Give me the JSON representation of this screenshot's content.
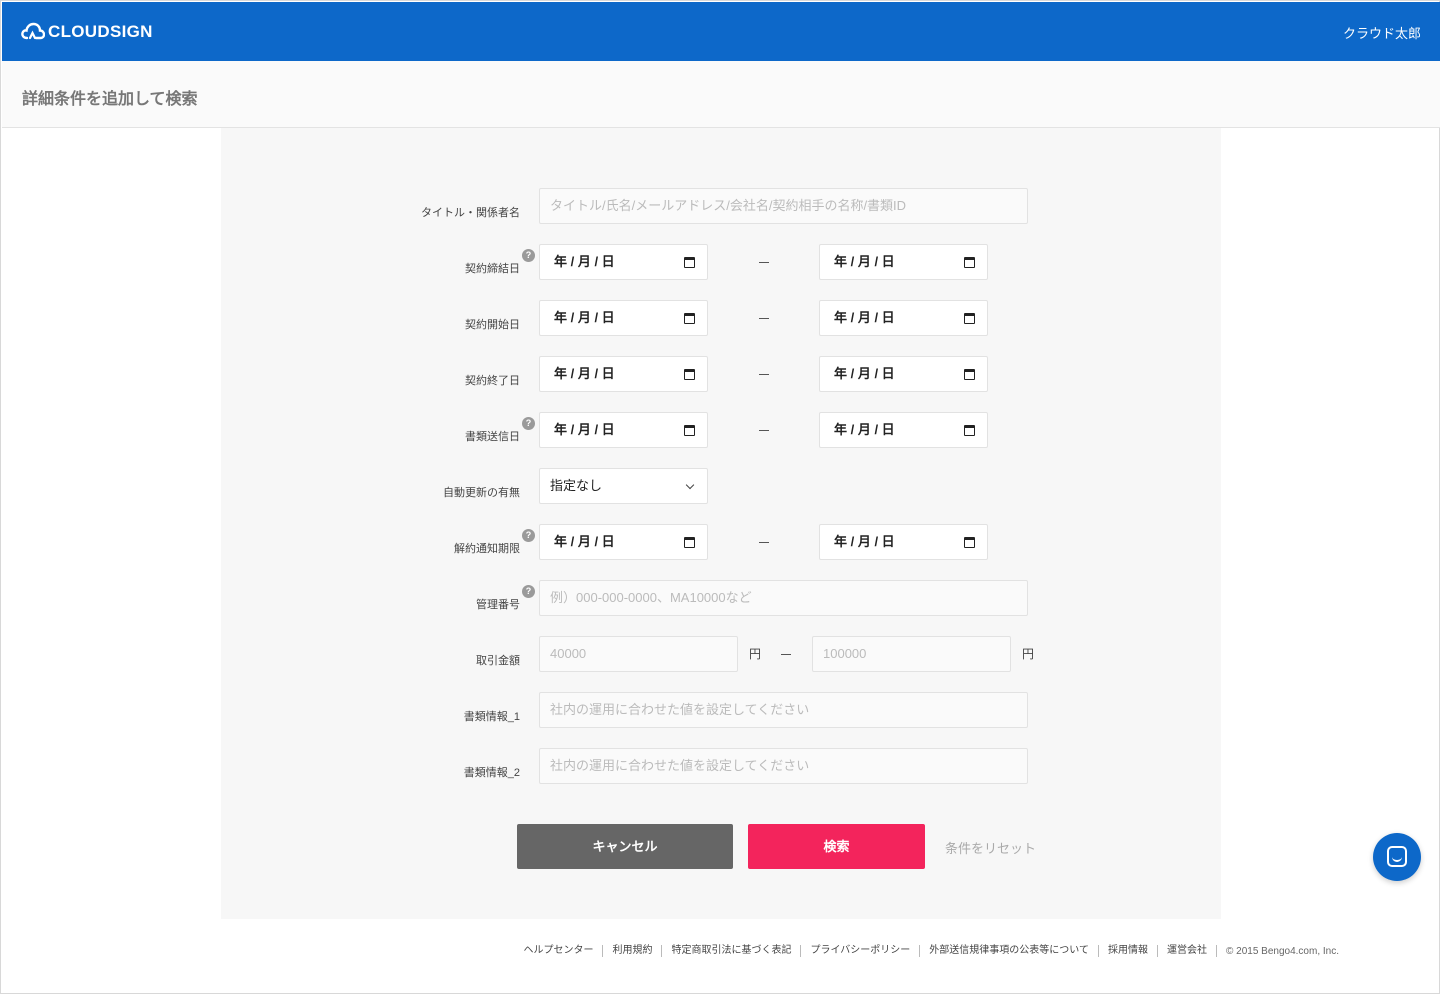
{
  "header": {
    "logo_text": "CLOUDSIGN",
    "user_name": "クラウド太郎",
    "brand_color": "#0d68c9"
  },
  "page": {
    "title": "詳細条件を追加して検索"
  },
  "form": {
    "title_field": {
      "label": "タイトル・関係者名",
      "placeholder": "タイトル/氏名/メールアドレス/会社名/契約相手の名称/書類ID"
    },
    "date_placeholder": "年 / 月 / 日",
    "contract_date": {
      "label": "契約締結日",
      "help": "?"
    },
    "start_date": {
      "label": "契約開始日"
    },
    "end_date": {
      "label": "契約終了日"
    },
    "sent_date": {
      "label": "書類送信日",
      "help": "?"
    },
    "auto_renew": {
      "label": "自動更新の有無",
      "value": "指定なし"
    },
    "cancel_notice": {
      "label": "解約通知期限",
      "help": "?"
    },
    "management_no": {
      "label": "管理番号",
      "help": "?",
      "placeholder": "例）000-000-0000、MA10000など"
    },
    "amount": {
      "label": "取引金額",
      "min_placeholder": "40000",
      "max_placeholder": "100000",
      "unit": "円"
    },
    "doc_info_1": {
      "label": "書類情報_1",
      "placeholder": "社内の運用に合わせた値を設定してください"
    },
    "doc_info_2": {
      "label": "書類情報_2",
      "placeholder": "社内の運用に合わせた値を設定してください"
    }
  },
  "actions": {
    "cancel_label": "キャンセル",
    "search_label": "検索",
    "reset_label": "条件をリセット",
    "search_color": "#f3245c"
  },
  "chat": {
    "icon": "chat-icon"
  },
  "footer": {
    "links": [
      "ヘルプセンター",
      "利用規約",
      "特定商取引法に基づく表記",
      "プライバシーポリシー",
      "外部送信規律事項の公表等について",
      "採用情報",
      "運営会社"
    ],
    "copyright": "© 2015 Bengo4.com, Inc."
  }
}
